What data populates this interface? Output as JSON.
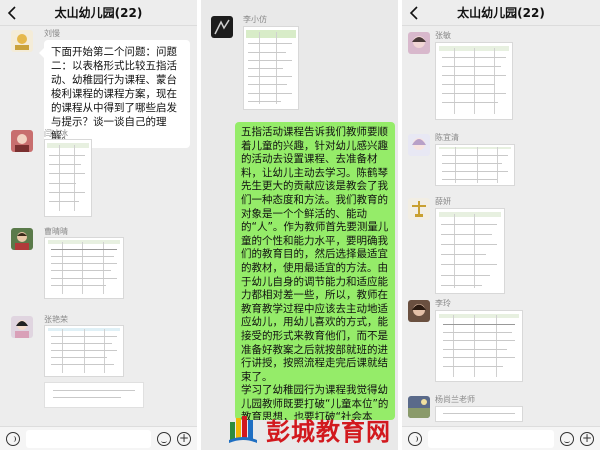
{
  "panel1": {
    "title": "太山幼儿园(22)",
    "messages": [
      {
        "sender": "刘慢",
        "text": "下面开始第二个问题：问题二：以表格形式比较五指活动、幼稚园行为课程、蒙台梭利课程的课程方案，现在的课程从中得到了哪些启发与提示？谈一谈自己的理解。"
      },
      {
        "sender": "闫冰冰"
      },
      {
        "sender": "曹晴晴"
      },
      {
        "sender": "张艳荣"
      }
    ]
  },
  "panel2": {
    "messages": [
      {
        "sender": "李小仿"
      },
      {
        "text": "五指活动课程告诉我们教师要顺着儿童的兴趣，针对幼儿感兴趣的活动去设置课程、去准备材料，让幼儿主动去学习。陈鹤琴先生更大的贡献应该是教会了我们一种态度和方法。我们教育的对象是一个个鲜活的、能动的“人”。作为教师首先要测量儿童的个性和能力水平，要明确我们的教育目的，然后选择最适宜的教材，使用最适宜的方法。由于幼儿自身的调节能力和适应能力都相对差一些，所以，教师在教育教学过程中应该去主动地适应幼儿，用幼儿喜欢的方式，能接受的形式来教育他们，而不是准备好教案之后就按部就班的进行讲授，按照流程走完后课就结束了。\n学习了幼稚园行为课程我觉得幼儿园教师既要打破“儿童本位”的教育思想，也要打破“社会本位”的教育思想，在课程设置与组织"
      }
    ]
  },
  "panel3": {
    "title": "太山幼儿园(22)",
    "messages": [
      {
        "sender": "张敏"
      },
      {
        "sender": "陈宜清"
      },
      {
        "sender": "薛妍"
      },
      {
        "sender": "李玲"
      },
      {
        "sender": "杨尚兰老师"
      }
    ]
  },
  "watermark": {
    "text": "彭城教育网"
  },
  "colors": {
    "green_bubble": "#95ec69",
    "chat_bg": "#ededed",
    "watermark_red": "#d2191e"
  }
}
